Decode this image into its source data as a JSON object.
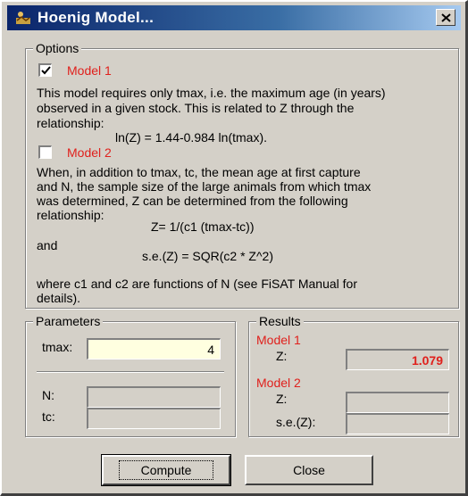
{
  "window": {
    "title": "Hoenig Model..."
  },
  "options": {
    "legend": "Options",
    "model1": {
      "checked": true,
      "label": "Model 1",
      "desc": [
        "This model requires only tmax, i.e. the maximum age (in years)",
        "observed in a given stock. This is related to Z through the",
        "relationship:"
      ],
      "formula": "ln(Z) = 1.44-0.984 ln(tmax)."
    },
    "model2": {
      "checked": false,
      "label": "Model 2",
      "desc": [
        "When, in addition to tmax, tc, the mean age at first capture",
        "and N, the sample size of the large animals from which tmax",
        "was determined, Z can be determined from the following",
        "relationship:"
      ],
      "formula1": "Z= 1/(c1 (tmax-tc))",
      "and": "and",
      "formula2": "s.e.(Z) = SQR(c2 * Z^2)",
      "note": [
        "where c1 and c2 are functions of N (see FiSAT Manual for",
        "details)."
      ]
    }
  },
  "parameters": {
    "legend": "Parameters",
    "tmax_label": "tmax:",
    "tmax_value": "4",
    "n_label": "N:",
    "n_value": "",
    "tc_label": "tc:",
    "tc_value": ""
  },
  "results": {
    "legend": "Results",
    "model1_label": "Model 1",
    "z1_label": "Z:",
    "z1_value": "1.079",
    "model2_label": "Model 2",
    "z2_label": "Z:",
    "z2_value": "",
    "se_label": "s.e.(Z):",
    "se_value": ""
  },
  "buttons": {
    "compute": "Compute",
    "close": "Close"
  },
  "colors": {
    "accent_red": "#e0201c",
    "title_blue": "#0a246a",
    "input_yellow": "#ffffe0"
  },
  "icons": {
    "title": "fish-app-icon",
    "close": "close-icon",
    "check": "checkmark-icon"
  }
}
